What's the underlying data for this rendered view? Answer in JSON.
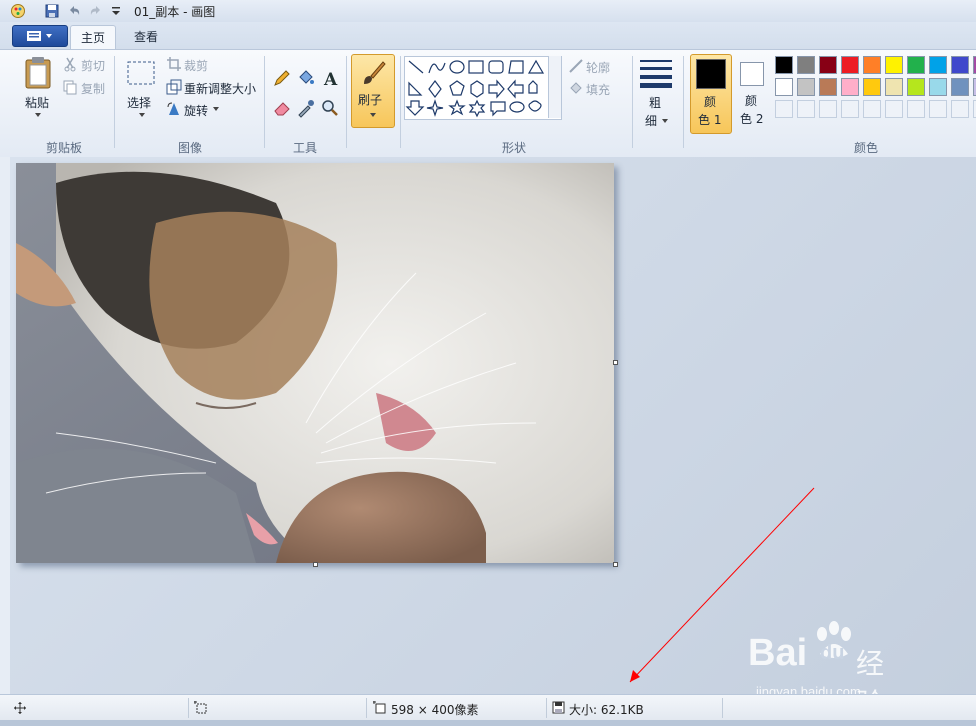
{
  "window": {
    "title": "01_副本 - 画图"
  },
  "tabs": [
    {
      "label": "主页"
    },
    {
      "label": "查看"
    }
  ],
  "ribbon": {
    "clipboard": {
      "paste": "粘贴",
      "cut": "剪切",
      "copy": "复制",
      "group": "剪贴板"
    },
    "image": {
      "select": "选择",
      "crop": "裁剪",
      "resize": "重新调整大小",
      "rotate": "旋转",
      "group": "图像"
    },
    "tools": {
      "group": "工具"
    },
    "brushes": {
      "label": "刷子"
    },
    "shapes": {
      "outline": "轮廓",
      "fill": "填充",
      "group": "形状"
    },
    "size": {
      "line1": "粗",
      "line2": "细"
    },
    "color1": {
      "line1": "颜",
      "line2": "色 1"
    },
    "color2": {
      "line1": "颜",
      "line2": "色 2"
    },
    "colors": {
      "group": "颜色",
      "row1": [
        "#000000",
        "#7f7f7f",
        "#880015",
        "#ed1c24",
        "#ff7f27",
        "#fff200",
        "#22b14c",
        "#00a2e8",
        "#3f48cc",
        "#a349a4"
      ],
      "row2": [
        "#ffffff",
        "#c3c3c3",
        "#b97a57",
        "#ffaec9",
        "#ffc90e",
        "#efe4b0",
        "#b5e61d",
        "#99d9ea",
        "#7092be",
        "#c8bfe7"
      ]
    }
  },
  "status": {
    "dimensions": "598 × 400像素",
    "size": "大小: 62.1KB"
  },
  "watermark": {
    "brand": "Bai",
    "brand2": "du",
    "site": "经验",
    "url": "jingyan.baidu.com"
  },
  "accent": "#ff0000"
}
